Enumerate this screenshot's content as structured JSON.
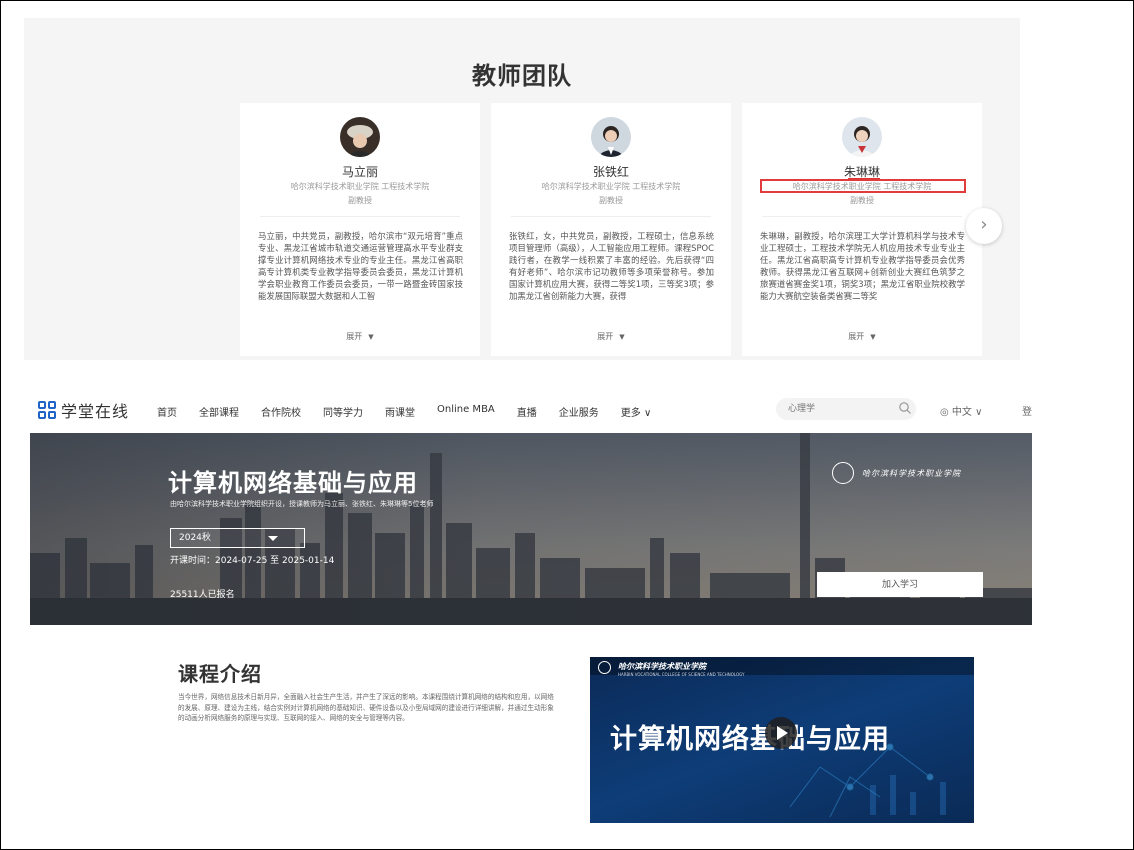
{
  "teacher_section": {
    "title": "教师团队",
    "teachers": [
      {
        "name": "马立丽",
        "school": "哈尔滨科学技术职业学院 工程技术学院",
        "rank": "副教授",
        "bio": "马立丽，中共党员，副教授，哈尔滨市“双元培育”重点专业、黑龙江省城市轨道交通运营管理高水平专业群支撑专业计算机网络技术专业的专业主任。黑龙江省高职高专计算机类专业教学指导委员会委员，黑龙江计算机学会职业教育工作委员会委员，一带一路暨金砖国家技能发展国际联盟大数据和人工智",
        "expand": "展开"
      },
      {
        "name": "张铁红",
        "school": "哈尔滨科学技术职业学院 工程技术学院",
        "rank": "副教授",
        "bio": "张铁红，女，中共党员，副教授，工程硕士，信息系统项目管理师（高级），人工智能应用工程师。课程SPOC践行者，在教学一线积累了丰富的经验。先后获得“四有好老师”、哈尔滨市记功教师等多项荣誉称号。参加国家计算机应用大赛，获得二等奖1项，三等奖3项；参加黑龙江省创新能力大赛，获得",
        "expand": "展开"
      },
      {
        "name": "朱琳琳",
        "school": "哈尔滨科学技术职业学院 工程技术学院",
        "rank": "副教授",
        "bio": "朱琳琳，副教授，哈尔滨理工大学计算机科学与技术专业工程硕士，工程技术学院无人机应用技术专业专业主任。黑龙江省高职高专计算机专业教学指导委员会优秀教师。获得黑龙江省互联网+创新创业大赛红色筑梦之旅赛道省赛金奖1项，铜奖3项；黑龙江省职业院校教学能力大赛航空装备类省赛二等奖",
        "expand": "展开"
      }
    ],
    "next_icon": "chevron-right-icon"
  },
  "nav": {
    "brand": "学堂在线",
    "links": [
      "首页",
      "全部课程",
      "合作院校",
      "同等学力",
      "雨课堂",
      "Online MBA",
      "直播",
      "企业服务",
      "更多 ∨"
    ],
    "search_placeholder": "心理学",
    "language": "◎ 中文 ∨",
    "clipped": "登"
  },
  "hero": {
    "title": "计算机网络基础与应用",
    "subtitle": "由哈尔滨科学技术职业学院组织开设，授课教师为马立丽、张铁红、朱琳琳等5位老师",
    "term": "2024秋",
    "dates": "开课时间：2024-07-25 至 2025-01-14",
    "enrolled": "25511人已报名",
    "join_label": "加入学习",
    "school_logo_text": "哈尔滨科学技术职业学院"
  },
  "intro": {
    "title": "课程介绍",
    "text": "当今世界，网络信息技术日新月异，全面融入社会生产生活，并产生了深远的影响。本课程围绕计算机网络的结构和应用，以网络的发展、原理、建设为主线，结合实例对计算机网络的基础知识、硬件设备以及小型局域网的建设进行详细讲解，并通过生动形象的动画分析网络服务的原理与实现、互联网的接入、网络的安全与管理等内容。",
    "video": {
      "school": "哈尔滨科学技术职业学院",
      "school_en": "HARBIN VOCATIONAL COLLEGE OF SCIENCE AND TECHNOLOGY",
      "title": "计算机网络基础与应用"
    }
  },
  "colors": {
    "highlight_box": "#e23b3b",
    "brand_blue": "#1e64c8",
    "panel_bg": "#f5f5f5",
    "video_bg": "#0e3d78"
  }
}
